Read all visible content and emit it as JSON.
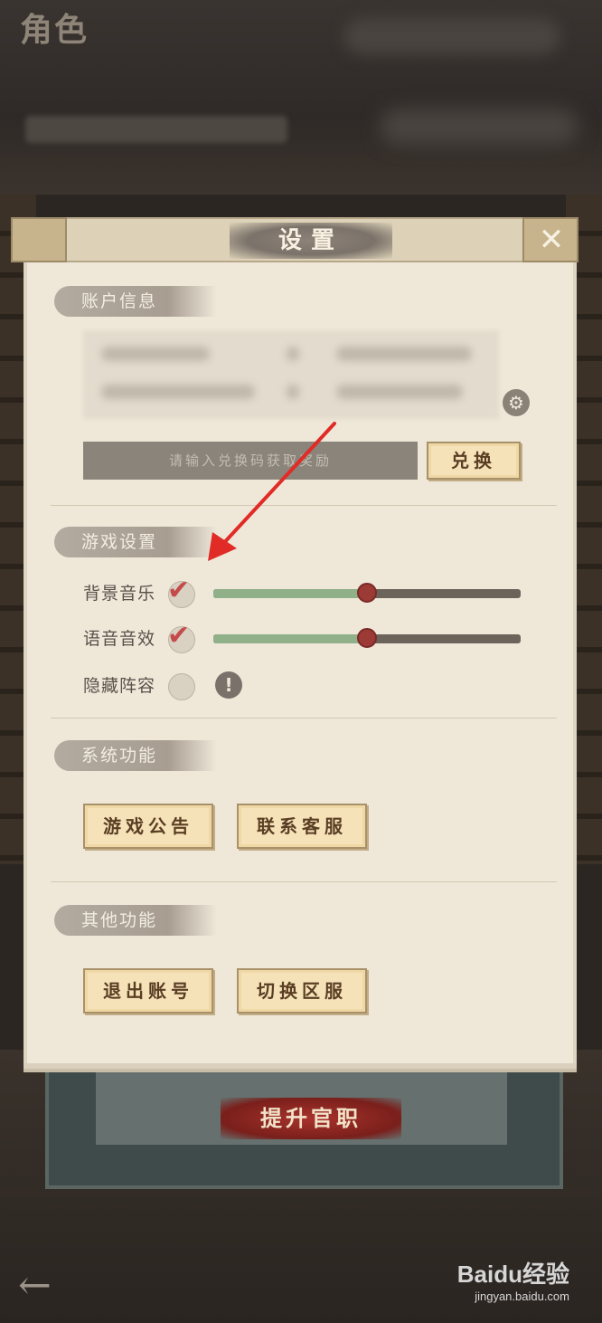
{
  "background": {
    "corner_title": "角色",
    "promote_button": "提升官职",
    "back_icon": "left-arrow-icon",
    "watermark": {
      "brand": "Baidu经验",
      "url": "jingyan.baidu.com"
    }
  },
  "dialog": {
    "title": "设置",
    "close_icon": "close-icon",
    "account": {
      "section_label": "账户信息",
      "code_placeholder": "请输入兑换码获取奖励",
      "redeem_label": "兑换",
      "settings_icon": "gear-icon"
    },
    "game": {
      "section_label": "游戏设置",
      "music": {
        "label": "背景音乐",
        "checked": true,
        "volume": 0.5
      },
      "voice": {
        "label": "语音音效",
        "checked": true,
        "volume": 0.5
      },
      "hide_lineup": {
        "label": "隐藏阵容",
        "checked": false,
        "info_icon": "exclamation-icon"
      }
    },
    "system": {
      "section_label": "系统功能",
      "buttons": [
        "游戏公告",
        "联系客服"
      ]
    },
    "other": {
      "section_label": "其他功能",
      "buttons": [
        "退出账号",
        "切换区服"
      ]
    }
  },
  "colors": {
    "accent_red": "#c44a4c",
    "slider_fill": "#8fb089",
    "button_bg": "#f6e2b8",
    "panel_bg": "#efe8d9",
    "annotation_arrow": "#e02b26"
  }
}
